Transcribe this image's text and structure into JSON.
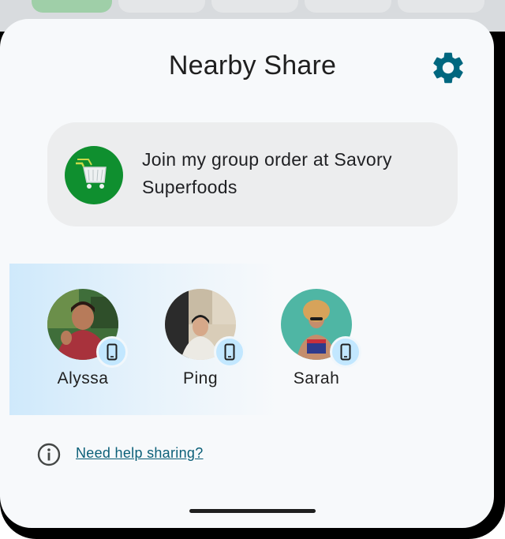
{
  "sheet": {
    "title": "Nearby Share",
    "settings_icon": "gear-icon",
    "accent_color": "#00677f"
  },
  "share_item": {
    "icon": "shopping-cart-icon",
    "icon_color": "#0f8f2f",
    "text": "Join my group order at Savory Superfoods"
  },
  "devices": [
    {
      "name": "Alyssa",
      "badge_icon": "phone-icon"
    },
    {
      "name": "Ping",
      "badge_icon": "phone-icon"
    },
    {
      "name": "Sarah",
      "badge_icon": "phone-icon"
    }
  ],
  "help": {
    "icon": "info-icon",
    "link_text": "Need help sharing?"
  }
}
